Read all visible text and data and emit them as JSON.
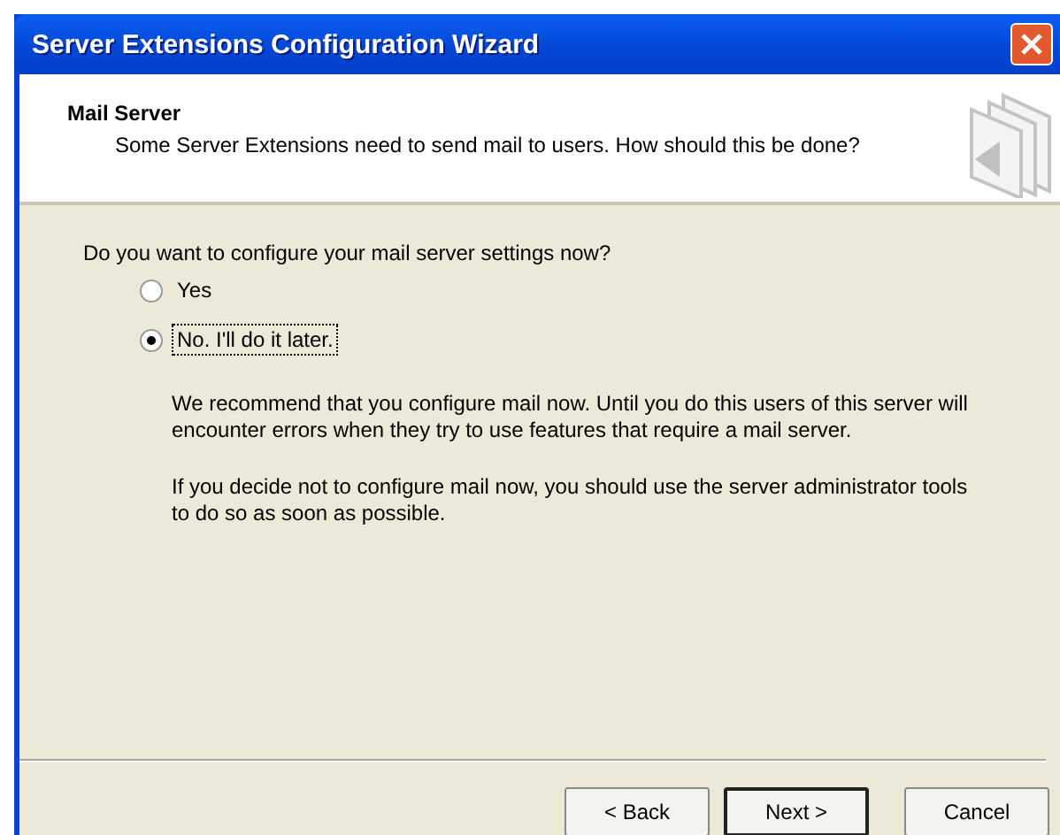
{
  "window": {
    "title": "Server Extensions Configuration Wizard"
  },
  "header": {
    "title": "Mail Server",
    "subtitle": "Some Server Extensions need to send mail to users. How should this be done?"
  },
  "question": "Do you want to configure your mail server settings now?",
  "options": [
    {
      "label": "Yes",
      "selected": false,
      "focused": false
    },
    {
      "label": "No. I'll do it later.",
      "selected": true,
      "focused": true
    }
  ],
  "paragraphs": [
    "We recommend that you configure mail now. Until you do this users of this server will encounter errors when they try to use features that require a mail server.",
    "If you decide not to configure mail now, you should use the server administrator tools to do so as soon as possible."
  ],
  "buttons": [
    {
      "label": "< Back",
      "default": false
    },
    {
      "label": "Next >",
      "default": true
    },
    {
      "label": "Cancel",
      "default": false
    }
  ]
}
